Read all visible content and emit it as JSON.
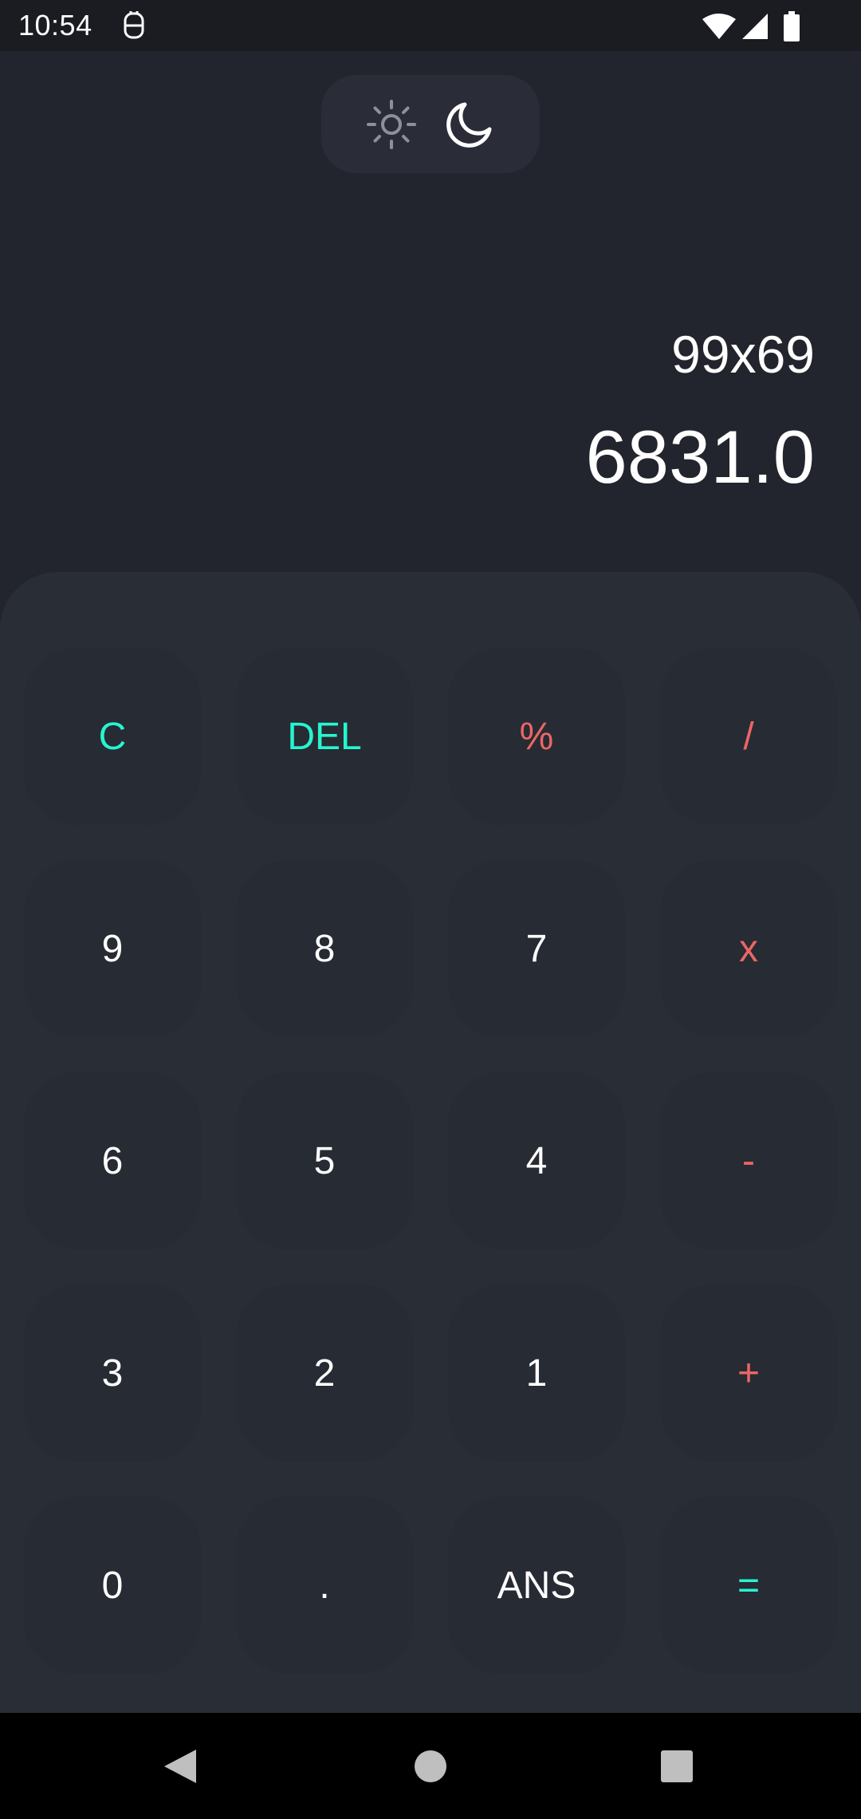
{
  "status_bar": {
    "time": "10:54",
    "icons": [
      "app-notification-icon",
      "wifi-icon",
      "signal-icon",
      "battery-icon"
    ]
  },
  "theme_toggle": {
    "options": [
      "light-mode-icon",
      "dark-mode-icon"
    ],
    "selected": "dark"
  },
  "display": {
    "expression": "99x69",
    "result": "6831.0"
  },
  "keypad": {
    "rows": [
      [
        "C",
        "DEL",
        "%",
        "/"
      ],
      [
        "9",
        "8",
        "7",
        "x"
      ],
      [
        "6",
        "5",
        "4",
        "-"
      ],
      [
        "3",
        "2",
        "1",
        "+"
      ],
      [
        "0",
        ".",
        "ANS",
        "="
      ]
    ]
  },
  "colors": {
    "background": "#22252d",
    "keypad_background": "#292d36",
    "key_background": "#272b33",
    "function_accent": "#26f5d0",
    "operator_accent": "#eb6666",
    "text": "#ffffff"
  },
  "nav_bar": {
    "icons": [
      "back-icon",
      "home-icon",
      "recents-icon"
    ]
  }
}
